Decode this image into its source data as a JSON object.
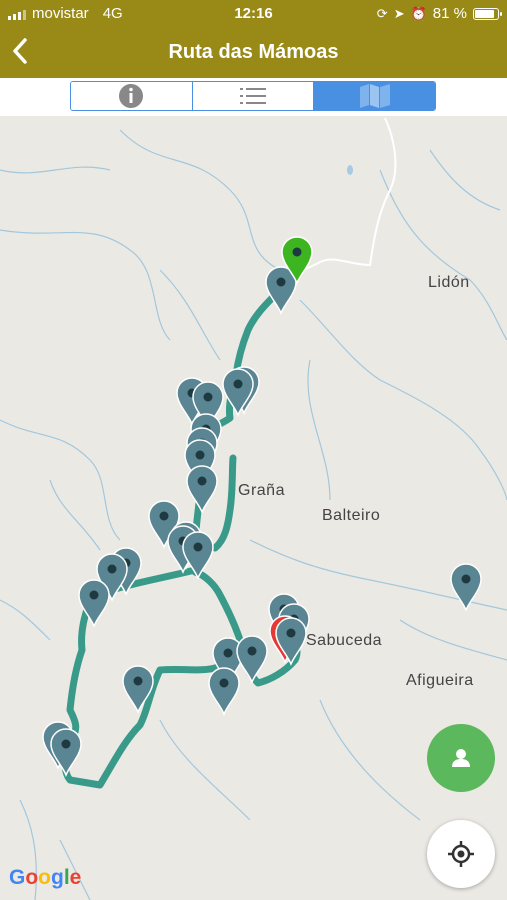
{
  "status_bar": {
    "carrier": "movistar",
    "network": "4G",
    "time": "12:16",
    "battery": "81 %",
    "battery_level": 0.81
  },
  "nav": {
    "title": "Ruta das Mámoas",
    "back_icon": "chevron-left-icon"
  },
  "tabs": [
    {
      "icon": "info-icon",
      "active": false
    },
    {
      "icon": "list-icon",
      "active": false
    },
    {
      "icon": "map-icon",
      "active": true
    }
  ],
  "map": {
    "labels": {
      "lidon": "Lidón",
      "grana": "Graña",
      "balteiro": "Balteiro",
      "sabuceda": "Sabuceda",
      "afigueira": "Afigueira"
    },
    "google_logo": "Google",
    "route_color": "#3a9a8a",
    "pin_color": "#5a8592",
    "start_pin_color": "#3cb521",
    "end_pin_color": "#e53935"
  },
  "buttons": {
    "person_icon": "person-icon",
    "locate_icon": "crosshair-icon"
  },
  "colors": {
    "header": "#998a17",
    "accent": "#4a90e2",
    "fab_green": "#5cb85c"
  }
}
